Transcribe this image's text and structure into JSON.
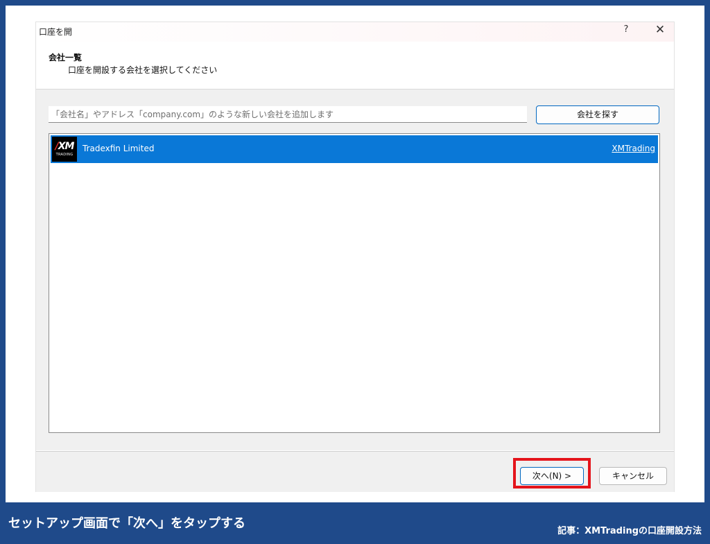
{
  "window": {
    "title": "口座を開",
    "help_label": "?",
    "close_label": "✕"
  },
  "header": {
    "heading": "会社一覧",
    "subheading": "口座を開設する会社を選択してください"
  },
  "search": {
    "placeholder": "「会社名」やアドレス「company.com」のような新しい会社を追加します",
    "value": "",
    "button_label": "会社を探す"
  },
  "companies": [
    {
      "logo_text": "XM",
      "logo_subtext": "TRADING",
      "name": "Tradexfin Limited",
      "link": "XMTrading",
      "selected": true
    }
  ],
  "footer": {
    "next_label": "次へ(N) >",
    "cancel_label": "キャンセル"
  },
  "caption": {
    "left": "セットアップ画面で「次へ」をタップする",
    "right": "記事：XMTradingの口座開設方法"
  },
  "colors": {
    "background": "#1f4a8a",
    "selection": "#0a78d7",
    "highlight": "#e4141b"
  }
}
